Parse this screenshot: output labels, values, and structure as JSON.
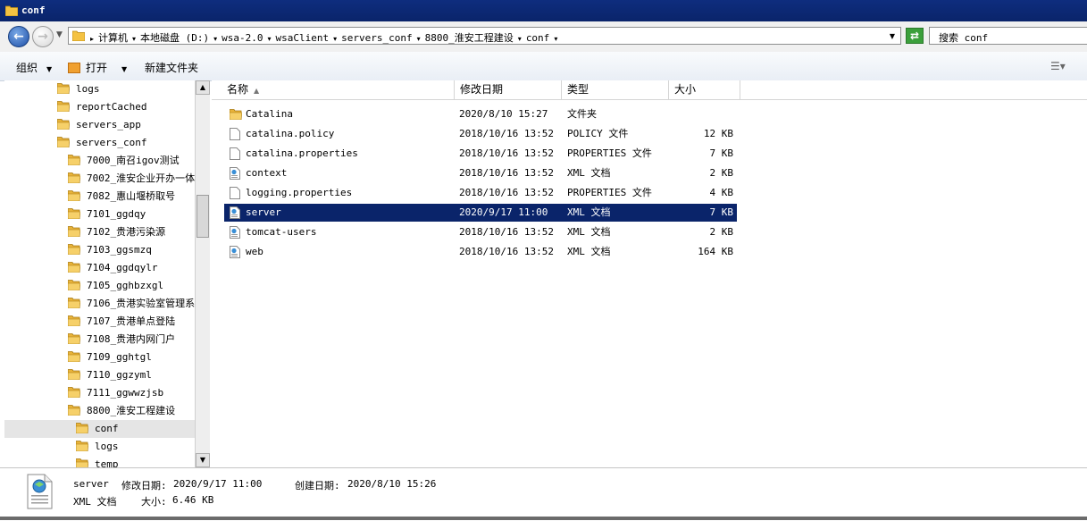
{
  "window": {
    "title": "conf"
  },
  "address": {
    "crumbs": [
      "计算机",
      "本地磁盘 (D:)",
      "wsa-2.0",
      "wsaClient",
      "servers_conf",
      "8800_淮安工程建设",
      "conf"
    ]
  },
  "search": {
    "text": "搜索 conf"
  },
  "toolbar": {
    "organize": "组织",
    "open": "打开",
    "new_folder": "新建文件夹"
  },
  "tree": [
    {
      "label": "logs",
      "indent": 1
    },
    {
      "label": "reportCached",
      "indent": 1
    },
    {
      "label": "servers_app",
      "indent": 1
    },
    {
      "label": "servers_conf",
      "indent": 1
    },
    {
      "label": "7000_南召igov测试",
      "indent": 2
    },
    {
      "label": "7002_淮安企业开办一体",
      "indent": 2
    },
    {
      "label": "7082_惠山堰桥取号",
      "indent": 2
    },
    {
      "label": "7101_ggdqy",
      "indent": 2
    },
    {
      "label": "7102_贵港污染源",
      "indent": 2
    },
    {
      "label": "7103_ggsmzq",
      "indent": 2
    },
    {
      "label": "7104_ggdqylr",
      "indent": 2
    },
    {
      "label": "7105_gghbzxgl",
      "indent": 2
    },
    {
      "label": "7106_贵港实验室管理系",
      "indent": 2
    },
    {
      "label": "7107_贵港单点登陆",
      "indent": 2
    },
    {
      "label": "7108_贵港内网门户",
      "indent": 2
    },
    {
      "label": "7109_gghtgl",
      "indent": 2
    },
    {
      "label": "7110_ggzyml",
      "indent": 2
    },
    {
      "label": "7111_ggwwzjsb",
      "indent": 2
    },
    {
      "label": "8800_淮安工程建设",
      "indent": 2
    },
    {
      "label": "conf",
      "indent": 3,
      "selected": true
    },
    {
      "label": "logs",
      "indent": 3
    },
    {
      "label": "temp",
      "indent": 3
    }
  ],
  "columns": {
    "name": "名称",
    "modified": "修改日期",
    "type": "类型",
    "size": "大小"
  },
  "files": [
    {
      "name": "Catalina",
      "modified": "2020/8/10 15:27",
      "type": "文件夹",
      "size": "",
      "icon": "folder-icon"
    },
    {
      "name": "catalina.policy",
      "modified": "2018/10/16 13:52",
      "type": "POLICY 文件",
      "size": "12 KB",
      "icon": "file-icon"
    },
    {
      "name": "catalina.properties",
      "modified": "2018/10/16 13:52",
      "type": "PROPERTIES 文件",
      "size": "7 KB",
      "icon": "file-icon"
    },
    {
      "name": "context",
      "modified": "2018/10/16 13:52",
      "type": "XML 文档",
      "size": "2 KB",
      "icon": "xml-file-icon"
    },
    {
      "name": "logging.properties",
      "modified": "2018/10/16 13:52",
      "type": "PROPERTIES 文件",
      "size": "4 KB",
      "icon": "file-icon"
    },
    {
      "name": "server",
      "modified": "2020/9/17 11:00",
      "type": "XML 文档",
      "size": "7 KB",
      "icon": "xml-file-icon",
      "selected": true
    },
    {
      "name": "tomcat-users",
      "modified": "2018/10/16 13:52",
      "type": "XML 文档",
      "size": "2 KB",
      "icon": "xml-file-icon"
    },
    {
      "name": "web",
      "modified": "2018/10/16 13:52",
      "type": "XML 文档",
      "size": "164 KB",
      "icon": "xml-file-icon"
    }
  ],
  "details": {
    "name": "server",
    "modified_label": "修改日期:",
    "modified": "2020/9/17 11:00",
    "created_label": "创建日期:",
    "created": "2020/8/10 15:26",
    "type": "XML 文档",
    "size_label": "大小:",
    "size": "6.46 KB"
  }
}
